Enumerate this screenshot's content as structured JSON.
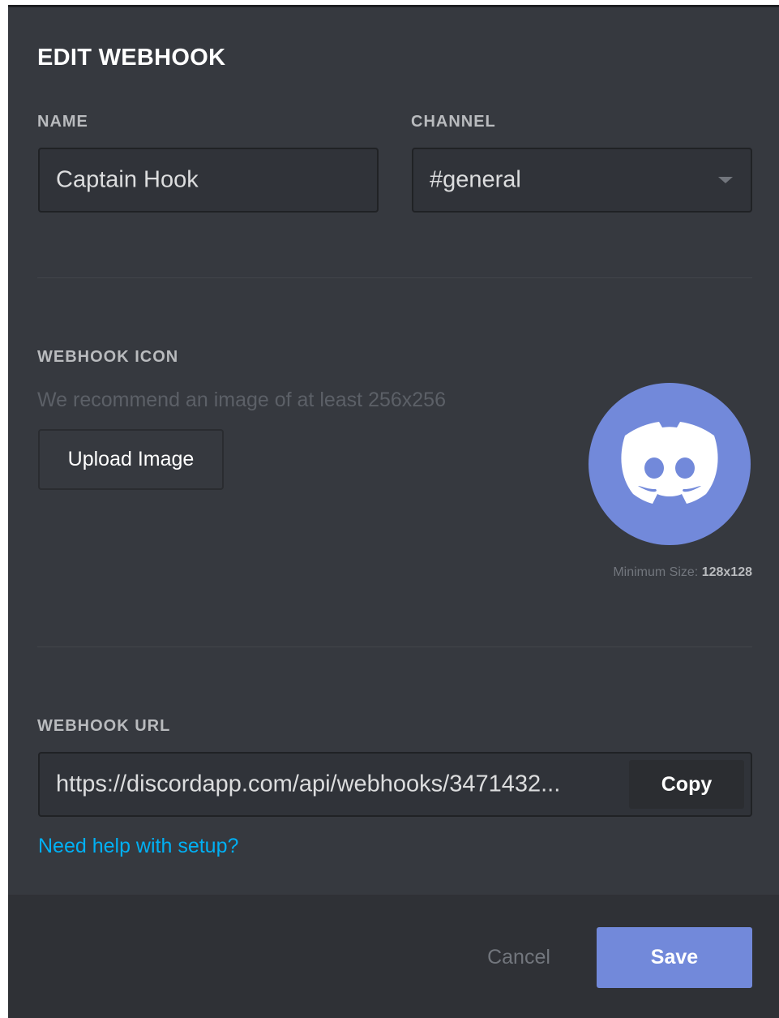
{
  "dialog": {
    "title": "EDIT WEBHOOK"
  },
  "name_field": {
    "label": "NAME",
    "value": "Captain Hook"
  },
  "channel_field": {
    "label": "CHANNEL",
    "value": "#general"
  },
  "icon_section": {
    "label": "WEBHOOK ICON",
    "hint": "We recommend an image of at least 256x256",
    "upload_label": "Upload Image",
    "avatar_icon": "discord-logo-icon",
    "min_size_label": "Minimum Size:",
    "min_size_value": "128x128"
  },
  "url_section": {
    "label": "WEBHOOK URL",
    "value": "https://discordapp.com/api/webhooks/3471432...",
    "copy_label": "Copy",
    "help_link": "Need help with setup?"
  },
  "footer": {
    "cancel_label": "Cancel",
    "save_label": "Save"
  },
  "colors": {
    "background": "#36393f",
    "footer": "#2f3136",
    "accent": "#7289da",
    "link": "#00b0f4"
  }
}
